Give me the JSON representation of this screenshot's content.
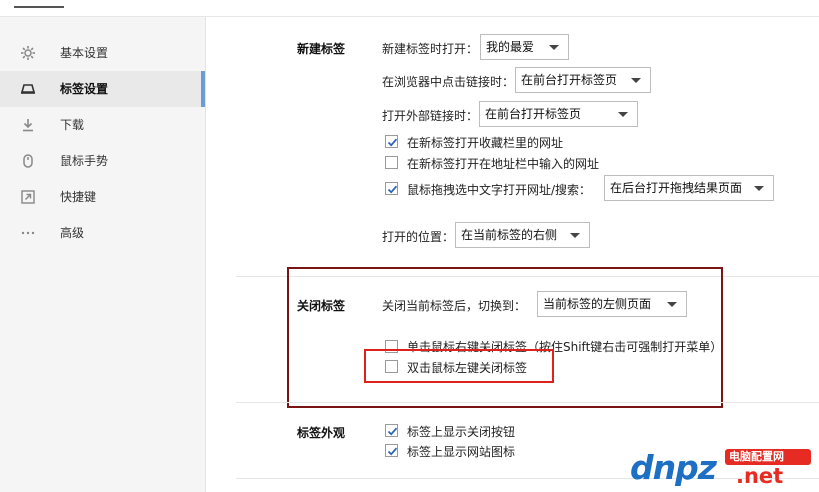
{
  "sidebar": {
    "items": [
      {
        "label": "基本设置",
        "icon": "gear-icon"
      },
      {
        "label": "标签设置",
        "icon": "tab-icon",
        "active": true
      },
      {
        "label": "下载",
        "icon": "download-icon"
      },
      {
        "label": "鼠标手势",
        "icon": "mouse-icon"
      },
      {
        "label": "快捷键",
        "icon": "shortcut-icon"
      },
      {
        "label": "高级",
        "icon": "more-icon"
      }
    ]
  },
  "new_tab": {
    "title": "新建标签",
    "open_label": "新建标签时打开：",
    "open_value": "我的最爱",
    "link_click_label": "在浏览器中点击链接时：",
    "link_click_value": "在前台打开标签页",
    "external_link_label": "打开外部链接时：",
    "external_link_value": "在前台打开标签页",
    "checkboxes": [
      {
        "label": "在新标签打开收藏栏里的网址",
        "checked": true
      },
      {
        "label": "在新标签打开在地址栏中输入的网址",
        "checked": false
      },
      {
        "label": "鼠标拖拽选中文字打开网址/搜索：",
        "checked": true
      }
    ],
    "drag_value": "在后台打开拖拽结果页面",
    "position_label": "打开的位置：",
    "position_value": "在当前标签的右侧"
  },
  "close_tab": {
    "title": "关闭标签",
    "switch_label": "关闭当前标签后，切换到：",
    "switch_value": "当前标签的左侧页面",
    "checkboxes": [
      {
        "label": "单击鼠标右键关闭标签（按住Shift键右击可强制打开菜单）",
        "checked": false
      },
      {
        "label": "双击鼠标左键关闭标签",
        "checked": false
      }
    ]
  },
  "appearance": {
    "title": "标签外观",
    "checkboxes": [
      {
        "label": "标签上显示关闭按钮",
        "checked": true
      },
      {
        "label": "标签上显示网站图标",
        "checked": true
      }
    ]
  },
  "watermark": {
    "brand": "dnpz",
    "site": "电脑配置网",
    "domain": ".net",
    "colors": {
      "blue": "#1d6fc4",
      "red": "#e62b22"
    }
  }
}
